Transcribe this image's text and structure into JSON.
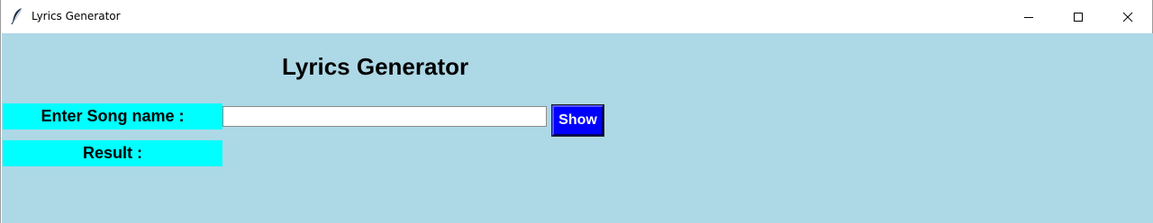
{
  "window": {
    "title": "Lyrics Generator",
    "app_icon": "feather-icon",
    "controls": [
      "minimize-icon",
      "maximize-icon",
      "close-icon"
    ]
  },
  "main": {
    "heading": "Lyrics Generator",
    "song_label": "Enter Song name :",
    "song_input_value": "",
    "show_button": "Show",
    "result_label": "Result :"
  },
  "colors": {
    "background": "#add8e6",
    "label_background": "#00ffff",
    "button_background": "#0000ff",
    "button_text": "#ffffff"
  }
}
